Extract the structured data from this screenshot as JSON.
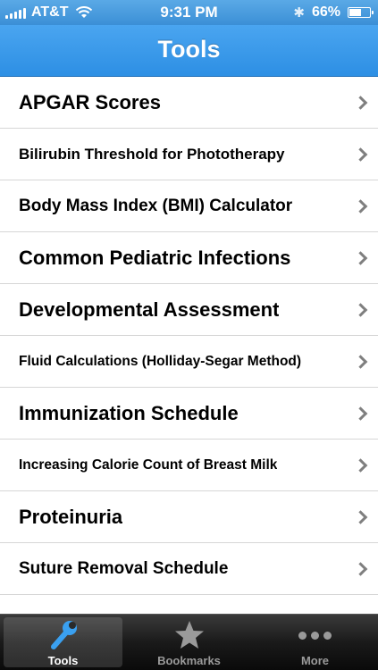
{
  "status_bar": {
    "carrier": "AT&T",
    "time": "9:31 PM",
    "battery": "66%",
    "battery_level": 0.66
  },
  "nav": {
    "title": "Tools"
  },
  "list": {
    "items": [
      {
        "label": "APGAR Scores"
      },
      {
        "label": "Bilirubin Threshold for Phototherapy"
      },
      {
        "label": "Body Mass Index (BMI) Calculator"
      },
      {
        "label": "Common Pediatric Infections"
      },
      {
        "label": "Developmental Assessment"
      },
      {
        "label": "Fluid Calculations (Holliday-Segar Method)"
      },
      {
        "label": "Immunization Schedule"
      },
      {
        "label": "Increasing Calorie Count of Breast Milk"
      },
      {
        "label": "Proteinuria"
      },
      {
        "label": "Suture Removal Schedule"
      }
    ]
  },
  "tab_bar": {
    "tabs": [
      {
        "label": "Tools",
        "icon": "wrench-icon",
        "selected": true
      },
      {
        "label": "Bookmarks",
        "icon": "star-icon",
        "selected": false
      },
      {
        "label": "More",
        "icon": "more-dots-icon",
        "selected": false
      }
    ]
  },
  "colors": {
    "nav_blue": "#3796e8",
    "tab_bar_dark": "#1a1a1a",
    "wrench_blue": "#3aa0f0",
    "inactive_gray": "#9a9a9a"
  }
}
